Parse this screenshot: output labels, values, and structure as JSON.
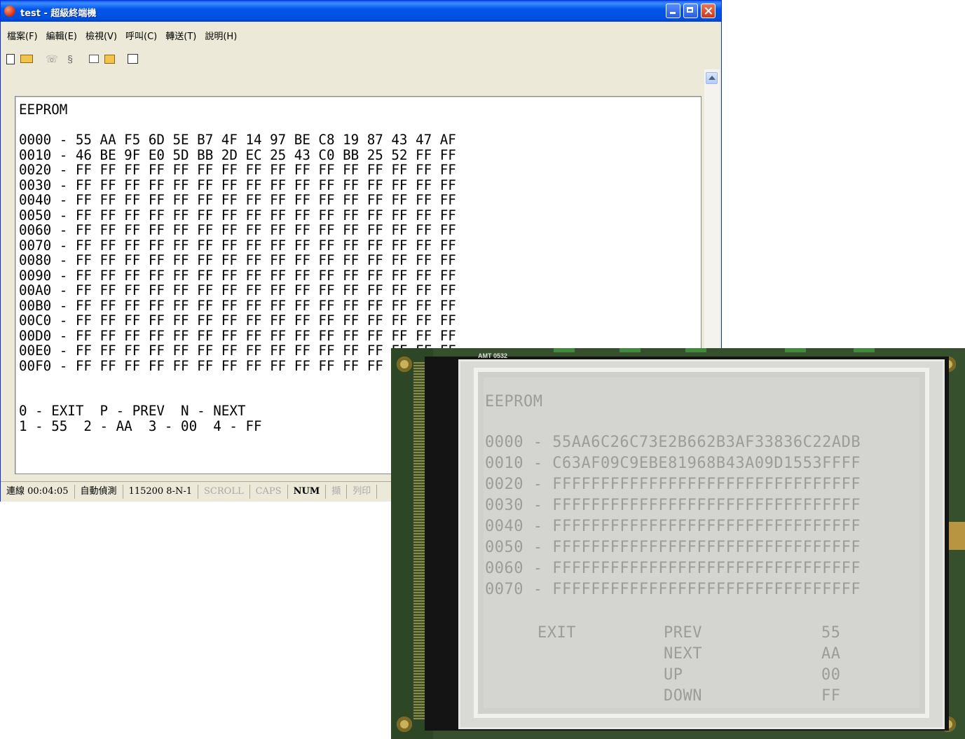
{
  "window": {
    "title": "test - 超級終端機",
    "controls": {
      "minimize": "minimize",
      "maximize": "maximize",
      "close": "close"
    }
  },
  "menu": [
    "檔案(F)",
    "編輯(E)",
    "檢視(V)",
    "呼叫(C)",
    "轉送(T)",
    "說明(H)"
  ],
  "toolbar": {
    "icons": [
      "new-document-icon",
      "open-folder-icon",
      "phone-icon",
      "disconnect-icon",
      "send-icon",
      "receive-icon",
      "properties-icon"
    ]
  },
  "terminal": {
    "heading": "EEPROM",
    "rows": [
      "0000 - 55 AA F5 6D 5E B7 4F 14 97 BE C8 19 87 43 47 AF",
      "0010 - 46 BE 9F E0 5D BB 2D EC 25 43 C0 BB 25 52 FF FF",
      "0020 - FF FF FF FF FF FF FF FF FF FF FF FF FF FF FF FF",
      "0030 - FF FF FF FF FF FF FF FF FF FF FF FF FF FF FF FF",
      "0040 - FF FF FF FF FF FF FF FF FF FF FF FF FF FF FF FF",
      "0050 - FF FF FF FF FF FF FF FF FF FF FF FF FF FF FF FF",
      "0060 - FF FF FF FF FF FF FF FF FF FF FF FF FF FF FF FF",
      "0070 - FF FF FF FF FF FF FF FF FF FF FF FF FF FF FF FF",
      "0080 - FF FF FF FF FF FF FF FF FF FF FF FF FF FF FF FF",
      "0090 - FF FF FF FF FF FF FF FF FF FF FF FF FF FF FF FF",
      "00A0 - FF FF FF FF FF FF FF FF FF FF FF FF FF FF FF FF",
      "00B0 - FF FF FF FF FF FF FF FF FF FF FF FF FF FF FF FF",
      "00C0 - FF FF FF FF FF FF FF FF FF FF FF FF FF FF FF FF",
      "00D0 - FF FF FF FF FF FF FF FF FF FF FF FF FF FF FF FF",
      "00E0 - FF FF FF FF FF FF FF FF FF FF FF FF FF FF FF FF",
      "00F0 - FF FF FF FF FF FF FF FF FF FF FF FF FF FF FF FF"
    ],
    "footer_line1": "0 - EXIT  P - PREV  N - NEXT",
    "footer_line2": "1 - 55  2 - AA  3 - 00  4 - FF"
  },
  "statusbar": {
    "connected": "連線 00:04:05",
    "detect": "自動偵測",
    "port": "115200 8-N-1",
    "scroll": "SCROLL",
    "caps": "CAPS",
    "num": "NUM",
    "capture": "擷",
    "print": "列印"
  },
  "lcd": {
    "model_label": "AMT 0532",
    "heading": "EEPROM",
    "rows": [
      "0000 - 55AA6C26C73E2B662B3AF33836C22ADB",
      "0010 - C63AF09C9EBE81968B43A09D1553FFFF",
      "0020 - FFFFFFFFFFFFFFFFFFFFFFFFFFFFFFFF",
      "0030 - FFFFFFFFFFFFFFFFFFFFFFFFFFFFFFFF",
      "0040 - FFFFFFFFFFFFFFFFFFFFFFFFFFFFFFFF",
      "0050 - FFFFFFFFFFFFFFFFFFFFFFFFFFFFFFFF",
      "0060 - FFFFFFFFFFFFFFFFFFFFFFFFFFFFFFFF",
      "0070 - FFFFFFFFFFFFFFFFFFFFFFFFFFFFFFFF"
    ],
    "menu_exit": "EXIT",
    "menu_nav": [
      "PREV",
      "NEXT",
      "UP",
      "DOWN"
    ],
    "menu_vals": [
      "55",
      "AA",
      "00",
      "FF"
    ]
  }
}
